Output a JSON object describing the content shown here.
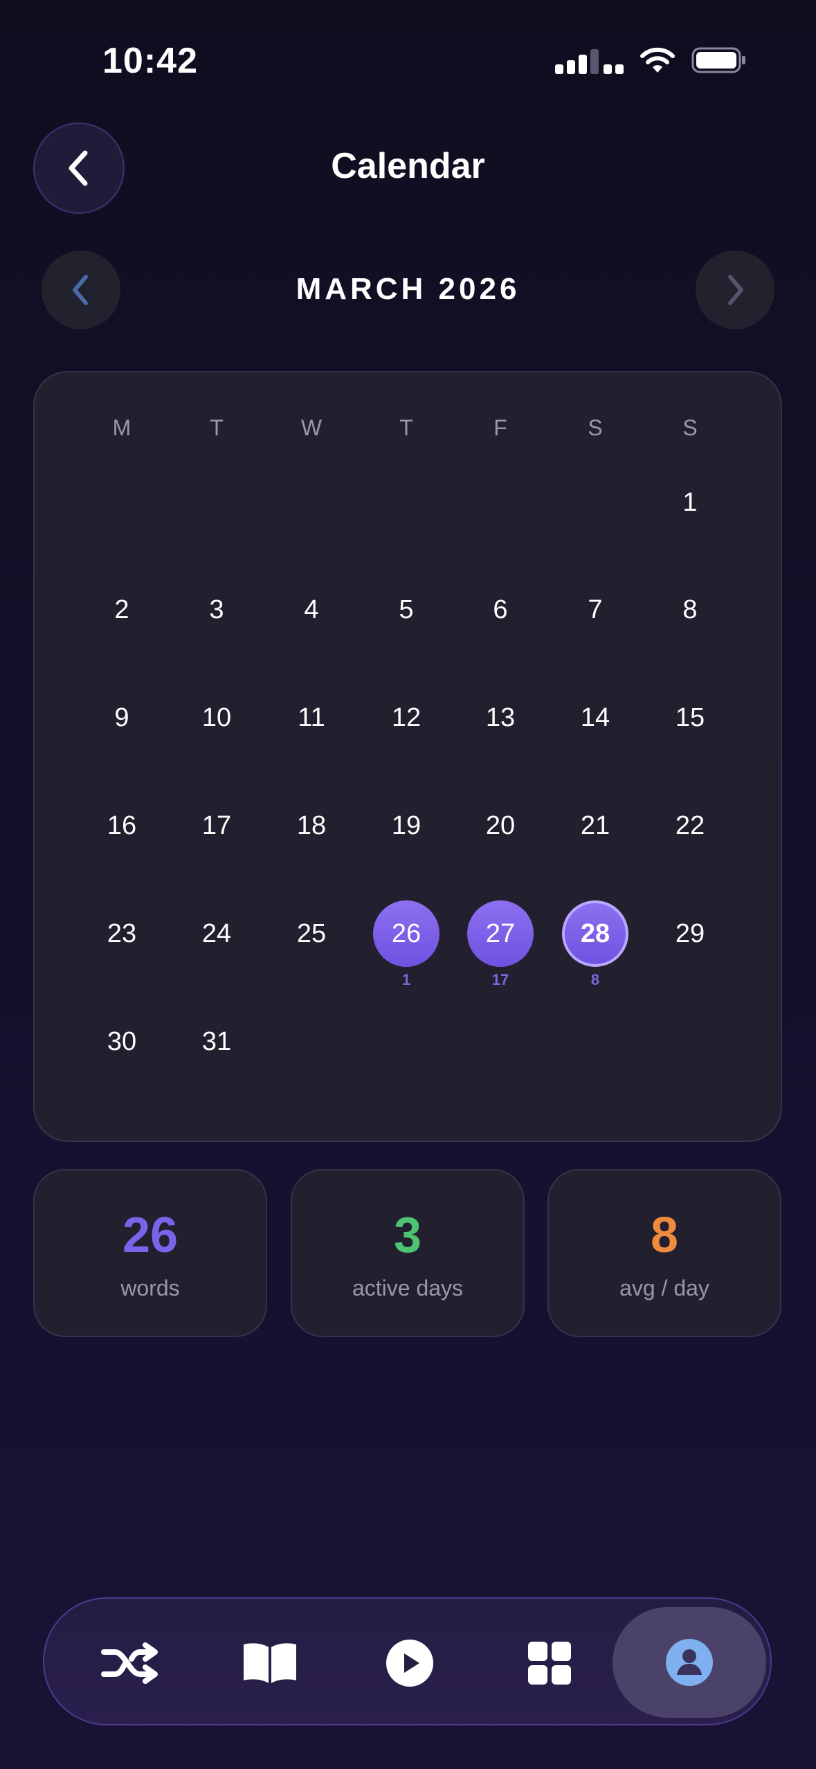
{
  "status_bar": {
    "time": "10:42"
  },
  "header": {
    "title": "Calendar"
  },
  "month_nav": {
    "label": "MARCH 2026"
  },
  "calendar": {
    "weekdays": [
      "M",
      "T",
      "W",
      "T",
      "F",
      "S",
      "S"
    ],
    "days": [
      {
        "d": "1"
      },
      {
        "d": "2"
      },
      {
        "d": "3"
      },
      {
        "d": "4"
      },
      {
        "d": "5"
      },
      {
        "d": "6"
      },
      {
        "d": "7"
      },
      {
        "d": "8"
      },
      {
        "d": "9"
      },
      {
        "d": "10"
      },
      {
        "d": "11"
      },
      {
        "d": "12"
      },
      {
        "d": "13"
      },
      {
        "d": "14"
      },
      {
        "d": "15"
      },
      {
        "d": "16"
      },
      {
        "d": "17"
      },
      {
        "d": "18"
      },
      {
        "d": "19"
      },
      {
        "d": "20"
      },
      {
        "d": "21"
      },
      {
        "d": "22"
      },
      {
        "d": "23"
      },
      {
        "d": "24"
      },
      {
        "d": "25"
      },
      {
        "d": "26",
        "count": "1"
      },
      {
        "d": "27",
        "count": "17"
      },
      {
        "d": "28",
        "count": "8",
        "today": true
      },
      {
        "d": "29"
      },
      {
        "d": "30"
      },
      {
        "d": "31"
      }
    ]
  },
  "stats": [
    {
      "value": "26",
      "label": "words",
      "color": "#7b63ec"
    },
    {
      "value": "3",
      "label": "active days",
      "color": "#4cc472"
    },
    {
      "value": "8",
      "label": "avg / day",
      "color": "#f08a3c"
    }
  ],
  "bottom_nav": {
    "items": [
      {
        "icon": "shuffle-icon"
      },
      {
        "icon": "book-icon"
      },
      {
        "icon": "play-icon"
      },
      {
        "icon": "grid-icon"
      },
      {
        "icon": "profile-icon",
        "selected": true
      }
    ]
  },
  "colors": {
    "accent": "#7b63ec",
    "profile_icon": "#7fb0f0"
  }
}
